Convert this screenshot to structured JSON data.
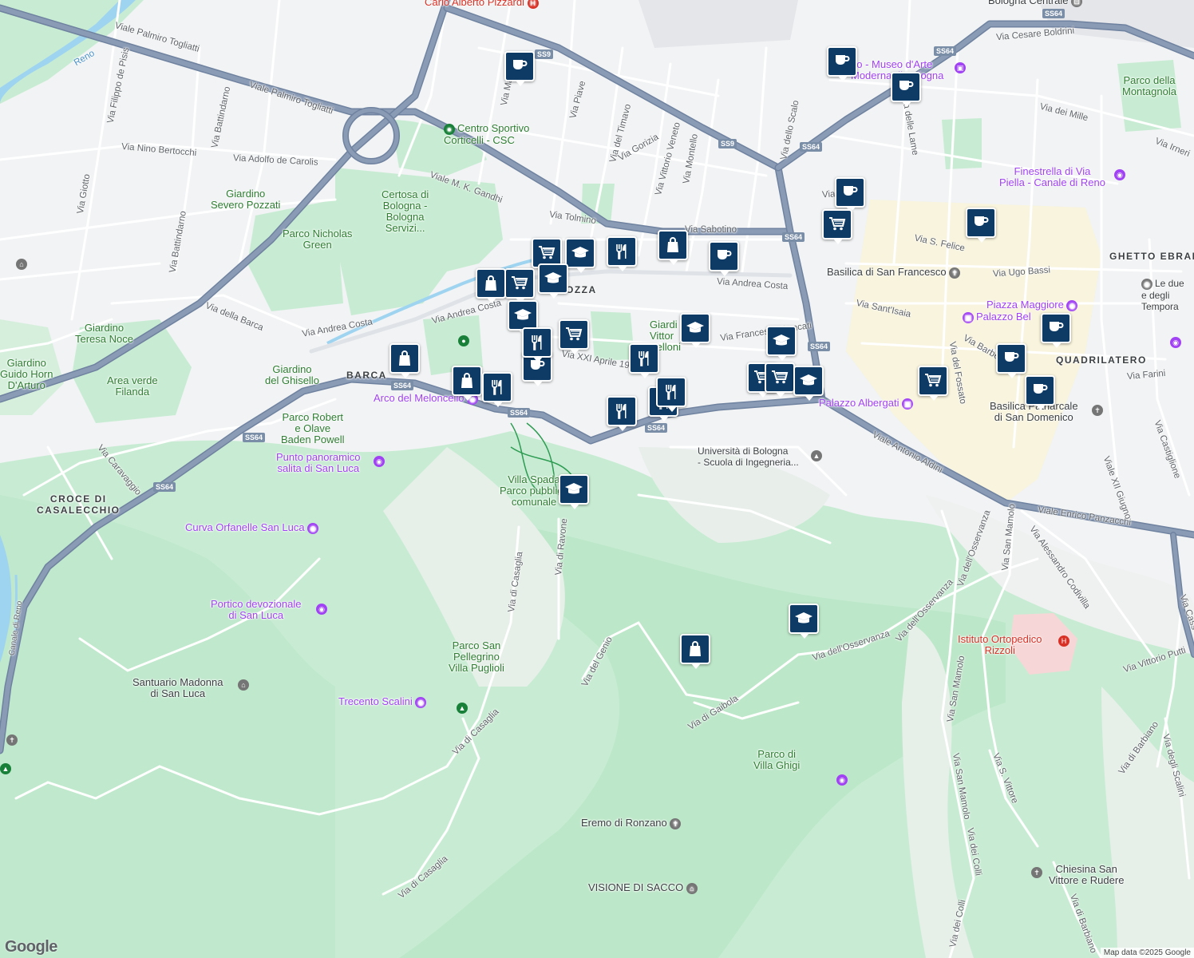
{
  "map": {
    "attribution": "Map data ©2025 Google",
    "logo": "Google"
  },
  "areas": {
    "barca": "BARCA",
    "croce": "CROCE DI\nCASALECCHIO",
    "ghetto": "GHETTO EBRAI",
    "quadrilatero": "QUADRILATERO",
    "saragozza_partial": "AGOZZA",
    "visione": "VISIONE DI SACCO"
  },
  "roads": {
    "palmiro_togliatti_1": "Viale Palmiro Togliatti",
    "palmiro_togliatti_2": "Viale Palmiro Togliatti",
    "filippo_de_pisis": "Via Filippo de Pisis",
    "nino_bertocchi": "Via Nino Bertocchi",
    "adolfo_de_carolis": "Via Adolfo de Carolis",
    "battindarno_1": "Via Battindarno",
    "battindarno_2": "Via Battindarno",
    "giotto": "Via Giotto",
    "mk_gandhi": "Viale M. K. Gandhi",
    "tolmino": "Via Tolmino",
    "sabotino": "Via Sabotino",
    "andrea_costa_1": "Via Andrea Costa",
    "andrea_costa_2": "Via Andrea Costa",
    "andrea_costa_3": "Via Andrea Costa",
    "della_barca": "Via della Barca",
    "caravaggio": "Via Caravaggio",
    "piave": "Via Piave",
    "del_timavo": "Via del Timavo",
    "gorizia": "Via Gorizia",
    "vittorio_veneto": "Via Vittorio Veneto",
    "montello": "Via Montello",
    "dello_scalo": "Via dello Scalo",
    "via_mar": "Via Mar",
    "xxi_aprile": "Via XXI Aprile 1945",
    "francesco_roncati": "Via Francesco Roncati",
    "s_felice_1": "Via S. F",
    "s_felice_2": "Via S. Felice",
    "ugo_bassi": "Via Ugo Bassi",
    "sant_isaia": "Via Sant'Isaia",
    "barberia": "Via Barberi",
    "del_fossato": "Via del Fossato",
    "farini": "Via Farini",
    "antonio_aldini": "Viale Antonio Aldini",
    "enrico_panzacchi": "Viale Enrico Panzacchi",
    "castiglione": "Via Castiglione",
    "xii_giugno": "Viale XII Giugno",
    "di_ravone": "Via di Ravone",
    "di_casaglia_1": "Via di Casaglia",
    "di_casaglia_2": "Via di Casaglia",
    "di_casaglia_3": "Via di Casaglia",
    "del_genio": "Via del Genio",
    "di_gaibola": "Via di Gaibola",
    "osservanza_1": "Via dell'Osservanza",
    "osservanza_2": "Via dell'Osservanza",
    "osservanza_3": "Via dell'Osservanza",
    "osservanza_4": "Via dell'Osservanza",
    "san_mamolo_1": "Via San Mamolo",
    "san_mamolo_2": "Via San Mamolo",
    "san_mamolo_3": "Via San Mamolo",
    "alessandro_codivilla": "Via Alessandro Codivilla",
    "vittorio_putti": "Via Vittorio Putti",
    "dei_colli_1": "Via dei Colli",
    "dei_colli_2": "Via dei Colli",
    "s_vittore": "Via S. Vittore",
    "di_barbiano_1": "Via di Barbiano",
    "di_barbiano_2": "Via di Barbiano",
    "degli_scalini": "Via degli Scalini",
    "dei_mille": "Via dei Mille",
    "irnerio": "Via Irneri",
    "cesare_boldrini": "Via Cesare Boldrini",
    "delle_lame": "Via delle Lame",
    "canale_di_reno": "Canale di Reno",
    "reno": "Reno",
    "cass": "Via Cass",
    "scalini": "Via degli Scalini"
  },
  "shields": [
    "SS9",
    "SS9",
    "SS64",
    "SS64",
    "SS64",
    "SS64",
    "SS64",
    "SS64",
    "SS64",
    "SS64",
    "SS64",
    "SS64"
  ],
  "places": {
    "centro_sportivo": "Centro Sportivo\nCorticelli - CSC",
    "certosa": "Certosa di\nBologna -\nBologna\nServizi...",
    "giardino_severo": "Giardino\nSevero Pozzati",
    "parco_nicholas": "Parco Nicholas\nGreen",
    "giardino_teresa": "Giardino\nTeresa Noce",
    "giardino_guido": "Giardino\nGuido Horn\nD'Arturo",
    "area_filanda": "Area verde\nFilanda",
    "giardino_ghisello": "Giardino\ndel Ghisello",
    "parco_robert": "Parco Robert\ne Olave\nBaden Powell",
    "villa_spada": "Villa Spada\nParco pubblico\ncomunale",
    "parco_san_pellegrino": "Parco San\nPellegrino\nVilla Puglioli",
    "parco_villa_ghigi": "Parco di\nVilla Ghigi",
    "parco_montagnola": "Parco della\nMontagnola",
    "giardini_vittorio": "Giardi\nVittor\nBelloni"
  },
  "pois": {
    "carlo_alberto": "Carlo Alberto Pizzardi",
    "bologna_centrale": "Bologna Centrale",
    "mambo": "bo - Museo d'Arte\nModerna di Bologna",
    "finestrella": "Finestrella di Via\nPiella - Canale di Reno",
    "basilica_francesco": "Basilica di San Francesco",
    "piazza_maggiore": "Piazza Maggiore",
    "palazzo_bel": "Palazzo Bel",
    "le_due": "Le due\ne degli\nTempora",
    "palazzo_albergati": "Palazzo Albergati",
    "basilica_domenico": "Basilica Patriarcale\ndi San Domenico",
    "universita": "Università di Bologna\n- Scuola di Ingegneria...",
    "arco_meloncello": "Arco del Meloncello",
    "punto_panoramico": "Punto panoramico\nsalita di San Luca",
    "curva_orfanelle": "Curva Orfanelle San Luca",
    "portico": "Portico devozionale\ndi San Luca",
    "santuario": "Santuario Madonna\ndi San Luca",
    "trecento": "Trecento Scalini",
    "eremo": "Eremo di Ronzano",
    "istituto": "Istituto Ortopedico\nRizzoli",
    "chiesina": "Chiesina San\nVittore e Rudere"
  },
  "markers": [
    {
      "type": "cafe",
      "icon": "cup-icon"
    },
    {
      "type": "cafe",
      "icon": "cup-icon"
    },
    {
      "type": "cafe",
      "icon": "cup-icon"
    },
    {
      "type": "cafe",
      "icon": "cup-icon"
    },
    {
      "type": "cafe",
      "icon": "cup-icon"
    },
    {
      "type": "cafe",
      "icon": "cup-icon"
    },
    {
      "type": "cafe",
      "icon": "cup-icon"
    },
    {
      "type": "cafe",
      "icon": "cup-icon"
    },
    {
      "type": "cafe",
      "icon": "cup-icon"
    },
    {
      "type": "cafe",
      "icon": "cup-icon"
    },
    {
      "type": "grocery",
      "icon": "cart-icon"
    },
    {
      "type": "grocery",
      "icon": "cart-icon"
    },
    {
      "type": "grocery",
      "icon": "cart-icon"
    },
    {
      "type": "grocery",
      "icon": "cart-icon"
    },
    {
      "type": "grocery",
      "icon": "cart-icon"
    },
    {
      "type": "grocery",
      "icon": "cart-icon"
    },
    {
      "type": "grocery",
      "icon": "cart-icon"
    },
    {
      "type": "school",
      "icon": "graduation-cap-icon"
    },
    {
      "type": "school",
      "icon": "graduation-cap-icon"
    },
    {
      "type": "school",
      "icon": "graduation-cap-icon"
    },
    {
      "type": "school",
      "icon": "graduation-cap-icon"
    },
    {
      "type": "school",
      "icon": "graduation-cap-icon"
    },
    {
      "type": "school",
      "icon": "graduation-cap-icon"
    },
    {
      "type": "school",
      "icon": "graduation-cap-icon"
    },
    {
      "type": "school",
      "icon": "graduation-cap-icon"
    },
    {
      "type": "shopping",
      "icon": "shopping-bag-icon"
    },
    {
      "type": "shopping",
      "icon": "shopping-bag-icon"
    },
    {
      "type": "shopping",
      "icon": "shopping-bag-icon"
    },
    {
      "type": "shopping",
      "icon": "shopping-bag-icon"
    },
    {
      "type": "shopping",
      "icon": "shopping-bag-icon"
    },
    {
      "type": "restaurant",
      "icon": "fork-knife-icon"
    },
    {
      "type": "restaurant",
      "icon": "fork-knife-icon"
    },
    {
      "type": "restaurant",
      "icon": "fork-knife-icon"
    },
    {
      "type": "restaurant",
      "icon": "fork-knife-icon"
    },
    {
      "type": "restaurant",
      "icon": "fork-knife-icon"
    },
    {
      "type": "restaurant",
      "icon": "fork-knife-icon"
    },
    {
      "type": "restaurant",
      "icon": "fork-knife-icon"
    }
  ],
  "colors": {
    "background": "#f1f3f4",
    "park": "#c8ecd3",
    "park_dark": "#b5e3c4",
    "highway": "#8a9bb5",
    "highway_edge": "#6f829f",
    "road": "#ffffff",
    "water": "#9fd4f0",
    "marker": "#0d3b66",
    "poi_purple": "#a142f4",
    "hospital_red": "#d93025",
    "pedestrian_yellow": "#fdf1c6"
  }
}
